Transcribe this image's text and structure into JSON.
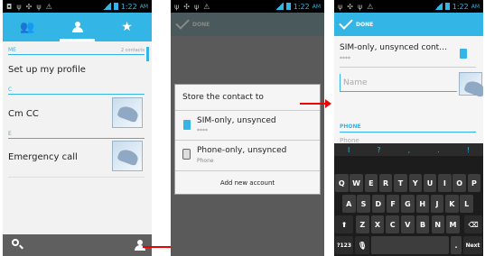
{
  "status": {
    "time": "1:22",
    "ampm": "AM"
  },
  "screen1": {
    "sections": {
      "me": "ME",
      "c": "C",
      "e": "E"
    },
    "contacts_count": "2 contacts",
    "rows": {
      "profile": "Set up my profile",
      "cm": "Cm CC",
      "emergency": "Emergency call"
    }
  },
  "screen2": {
    "done": "DONE",
    "dialog_title": "Store the contact to",
    "options": [
      {
        "label": "SIM-only, unsynced",
        "sub": "****"
      },
      {
        "label": "Phone-only, unsynced",
        "sub": "Phone"
      }
    ],
    "add_account": "Add new account"
  },
  "screen3": {
    "done": "DONE",
    "account": "SIM-only, unsynced cont…",
    "account_sub": "****",
    "name_placeholder": "Name",
    "phone_section": "PHONE",
    "phone_hint": "Phone",
    "suggestions": [
      "I",
      "?",
      ",",
      ".",
      "!"
    ],
    "kb_row1": [
      "Q",
      "W",
      "E",
      "R",
      "T",
      "Y",
      "U",
      "I",
      "O",
      "P"
    ],
    "kb_row2": [
      "A",
      "S",
      "D",
      "F",
      "G",
      "H",
      "J",
      "K",
      "L"
    ],
    "kb_row3": [
      "Z",
      "X",
      "C",
      "V",
      "B",
      "N",
      "M"
    ],
    "kb_num": "?123",
    "kb_dot": ".",
    "kb_next": "Next"
  }
}
